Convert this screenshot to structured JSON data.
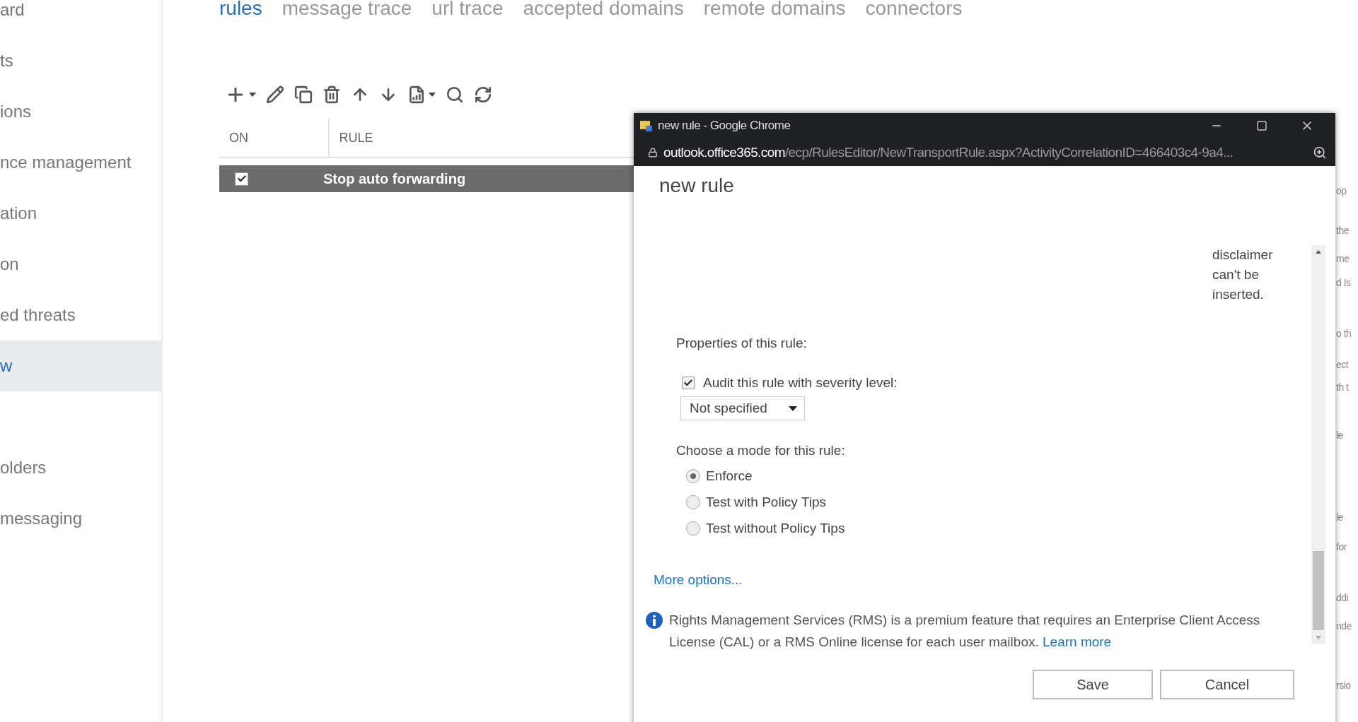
{
  "sidebar": {
    "items": [
      {
        "label": "ard",
        "selected": false
      },
      {
        "label": "ts",
        "selected": false
      },
      {
        "label": "ions",
        "selected": false
      },
      {
        "label": "nce management",
        "selected": false
      },
      {
        "label": "ation",
        "selected": false
      },
      {
        "label": "on",
        "selected": false
      },
      {
        "label": "ed threats",
        "selected": false
      },
      {
        "label": "w",
        "selected": true
      },
      {
        "label": "olders",
        "selected": false,
        "gap_before": true
      },
      {
        "label": "messaging",
        "selected": false
      }
    ]
  },
  "tabs": [
    {
      "label": "rules",
      "selected": true
    },
    {
      "label": "message trace",
      "selected": false
    },
    {
      "label": "url trace",
      "selected": false
    },
    {
      "label": "accepted domains",
      "selected": false
    },
    {
      "label": "remote domains",
      "selected": false
    },
    {
      "label": "connectors",
      "selected": false
    }
  ],
  "rules_table": {
    "columns": [
      "ON",
      "RULE"
    ],
    "rows": [
      {
        "on": true,
        "name": "Stop auto forwarding",
        "selected": true
      }
    ]
  },
  "background_fragments": [
    "op",
    "the",
    "me",
    "d Is",
    "o th",
    "ect",
    "th t",
    "le",
    "le",
    "for",
    "ddi",
    "nde",
    "rsio"
  ],
  "popup": {
    "title": "new rule - Google Chrome",
    "url_host": "outlook.office365.com",
    "url_path": "/ecp/RulesEditor/NewTransportRule.aspx?ActivityCorrelationID=466403c4-9a4...",
    "heading": "new rule",
    "disclaimer_note": "disclaimer can't be inserted.",
    "properties_label": "Properties of this rule:",
    "audit": {
      "label": "Audit this rule with severity level:",
      "checked": true
    },
    "severity": {
      "value": "Not specified"
    },
    "mode_label": "Choose a mode for this rule:",
    "modes": [
      {
        "label": "Enforce",
        "selected": true
      },
      {
        "label": "Test with Policy Tips",
        "selected": false
      },
      {
        "label": "Test without Policy Tips",
        "selected": false
      }
    ],
    "more_options": "More options...",
    "info": {
      "text": "Rights Management Services (RMS) is a premium feature that requires an Enterprise Client Access License (CAL) or a RMS Online license for each user mailbox.",
      "link": "Learn more"
    },
    "buttons": [
      "Save",
      "Cancel"
    ]
  }
}
